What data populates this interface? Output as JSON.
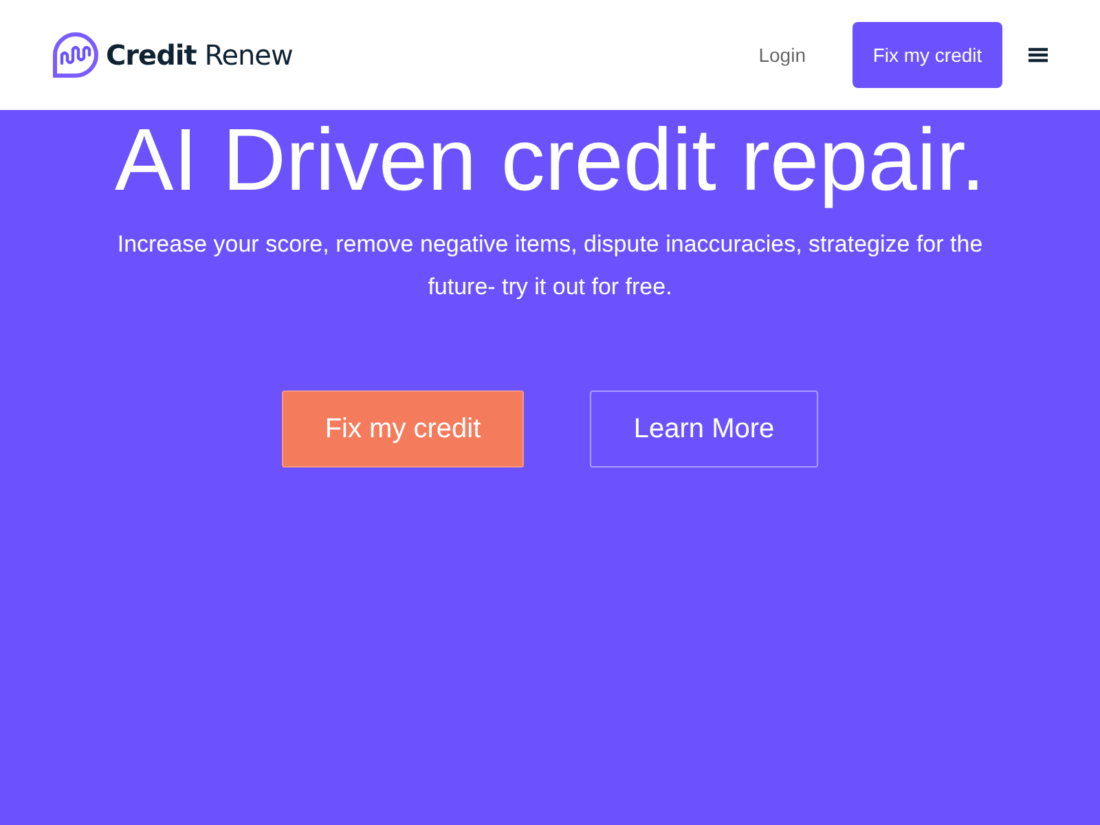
{
  "header": {
    "logo": "**Credit** Renew",
    "login": "Login",
    "cta": "Fix my credit"
  },
  "hero": {
    "title": "AI Driven credit repair.",
    "subtitle": "Increase your score, remove negative items, dispute inaccuracies, strategize for the future- try it out for free.",
    "buttons": [
      {
        "label": "Fix my credit",
        "kind": "primary"
      },
      {
        "label": "Learn More",
        "kind": "outline"
      }
    ]
  }
}
